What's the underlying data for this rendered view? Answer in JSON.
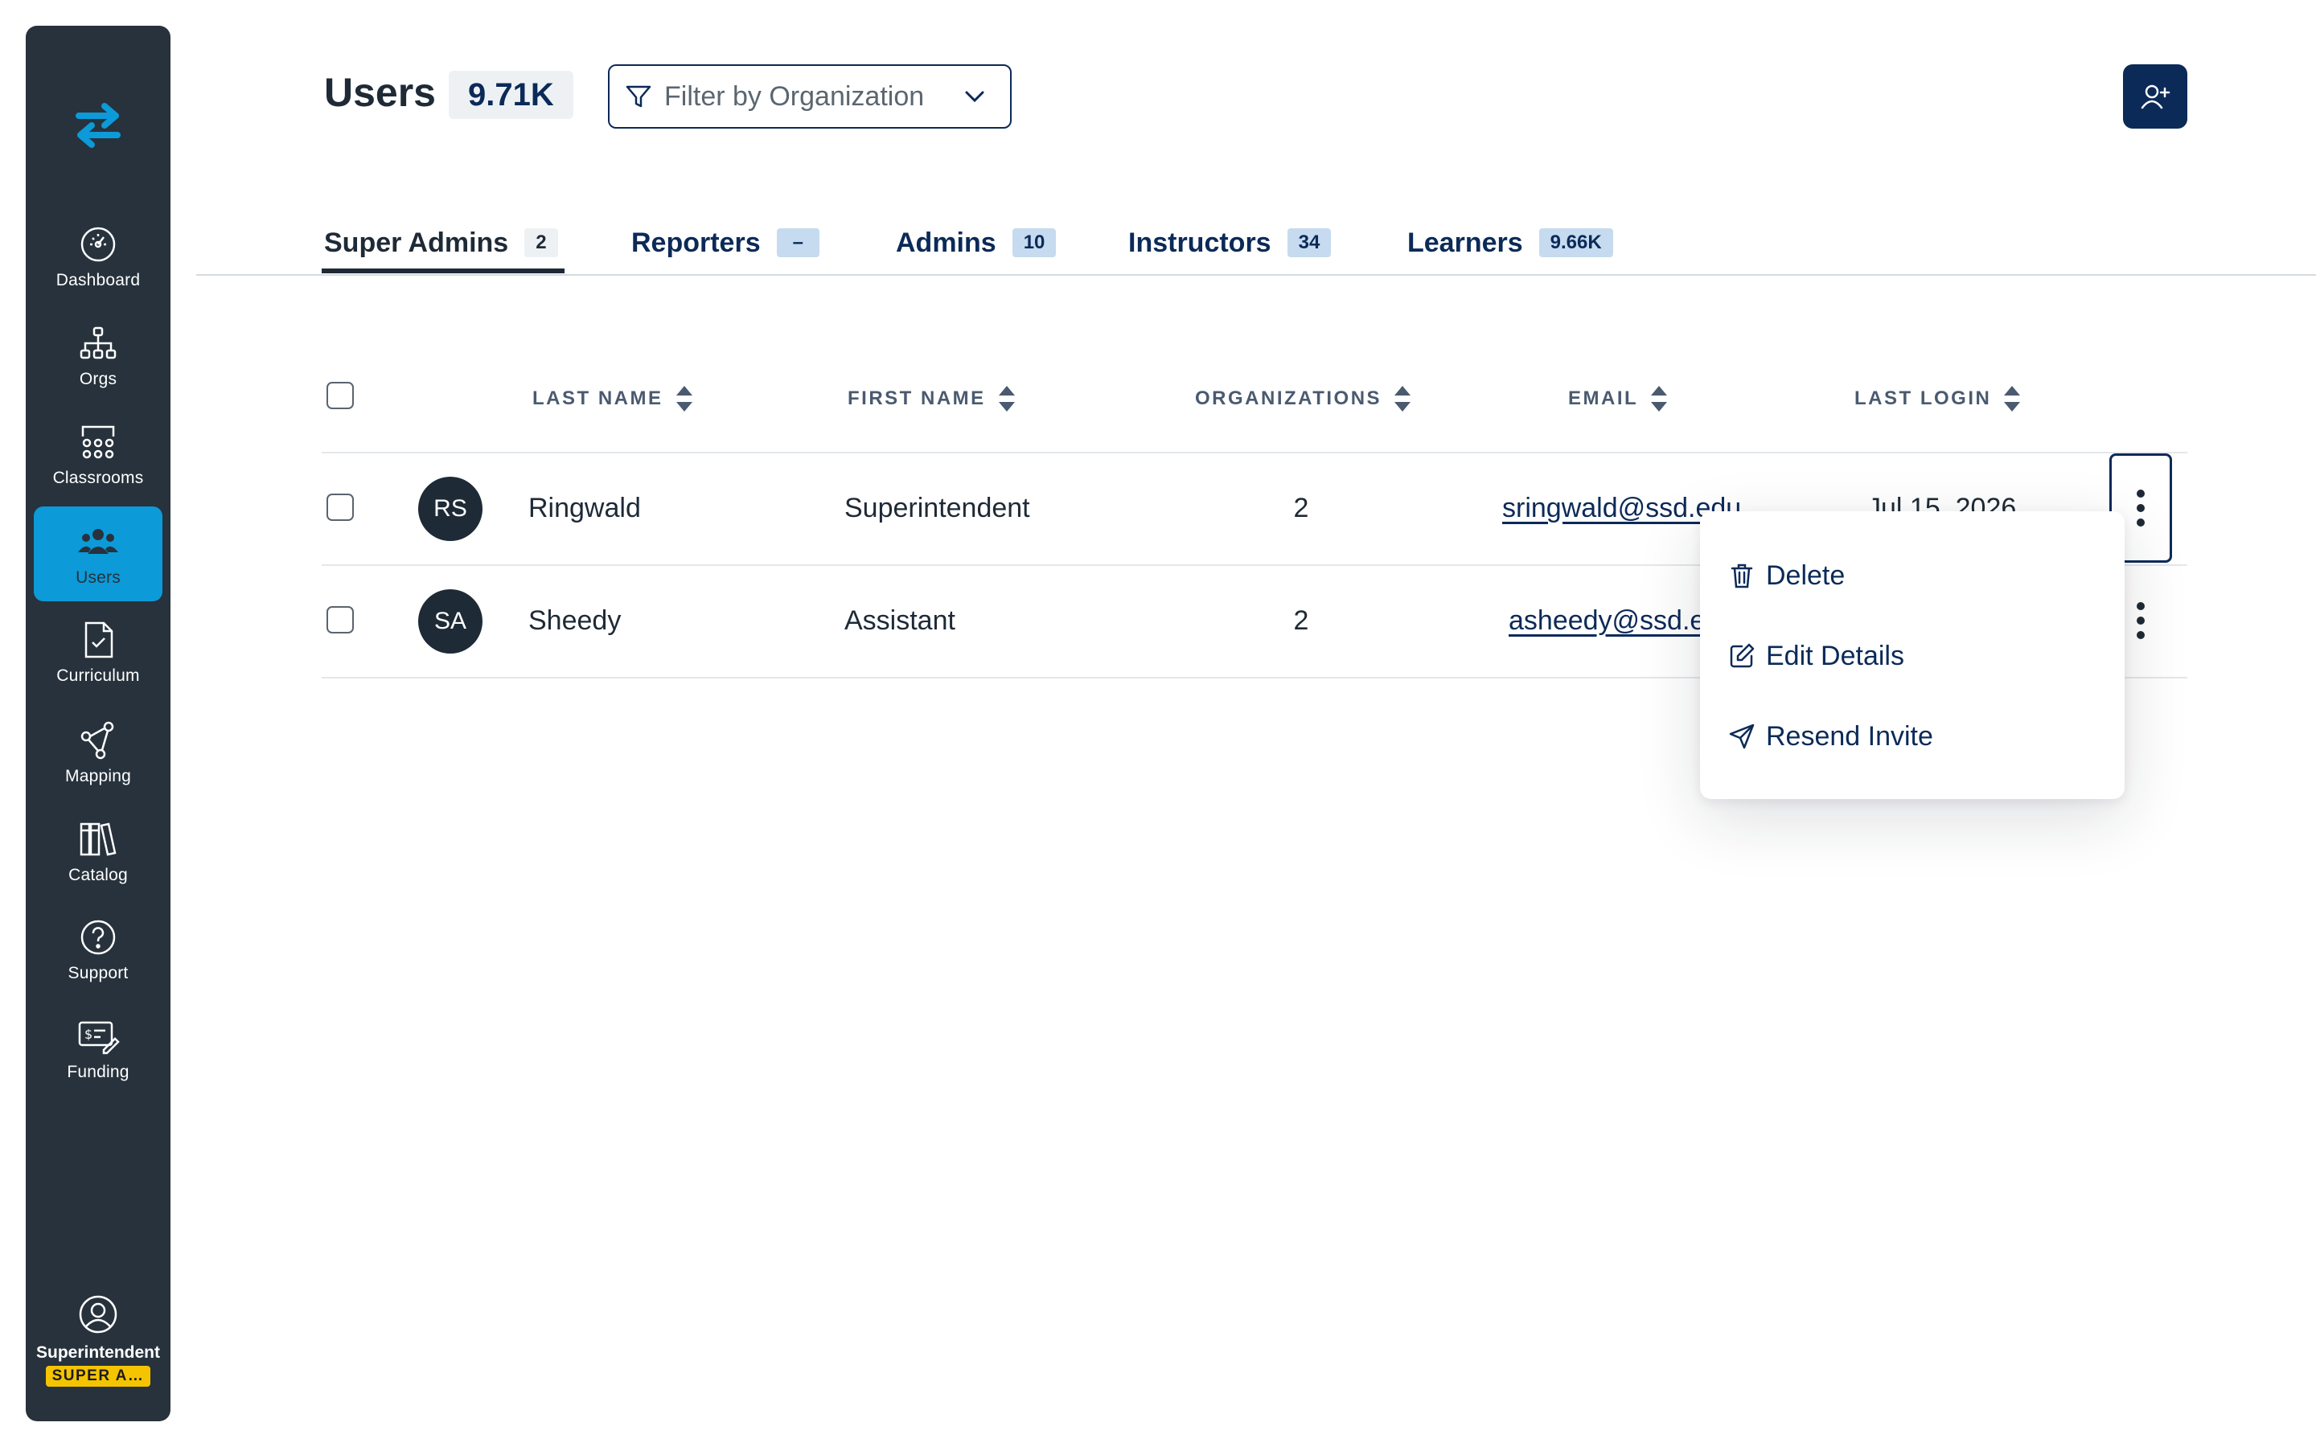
{
  "sidebar": {
    "logo_icon": "swap-arrows-icon",
    "items": [
      {
        "label": "Dashboard",
        "icon": "dashboard-icon"
      },
      {
        "label": "Orgs",
        "icon": "org-chart-icon"
      },
      {
        "label": "Classrooms",
        "icon": "classroom-icon"
      },
      {
        "label": "Users",
        "icon": "users-icon",
        "active": true
      },
      {
        "label": "Curriculum",
        "icon": "curriculum-icon"
      },
      {
        "label": "Mapping",
        "icon": "mapping-icon"
      },
      {
        "label": "Catalog",
        "icon": "catalog-icon"
      },
      {
        "label": "Support",
        "icon": "help-icon"
      },
      {
        "label": "Funding",
        "icon": "funding-icon"
      }
    ],
    "profile": {
      "name": "Superintendent",
      "role": "SUPER A…",
      "icon": "user-circle-icon"
    },
    "accent_color": "#0c9ad8",
    "background": "#27323c"
  },
  "header": {
    "title": "Users",
    "count": "9.71K",
    "filter_placeholder": "Filter by Organization",
    "add_user_icon": "add-user-icon"
  },
  "tabs": [
    {
      "label": "Super Admins",
      "count": "2",
      "active": true
    },
    {
      "label": "Reporters",
      "count": "–"
    },
    {
      "label": "Admins",
      "count": "10"
    },
    {
      "label": "Instructors",
      "count": "34"
    },
    {
      "label": "Learners",
      "count": "9.66K"
    }
  ],
  "table": {
    "columns": [
      "LAST NAME",
      "FIRST NAME",
      "ORGANIZATIONS",
      "EMAIL",
      "LAST LOGIN"
    ],
    "rows": [
      {
        "initials": "RS",
        "last_name": "Ringwald",
        "first_name": "Superintendent",
        "organizations": "2",
        "email": "sringwald@ssd.edu",
        "last_login": "Jul 15, 2026"
      },
      {
        "initials": "SA",
        "last_name": "Sheedy",
        "first_name": "Assistant",
        "organizations": "2",
        "email": "asheedy@ssd.e",
        "last_login": ""
      }
    ]
  },
  "row_menu": {
    "items": [
      {
        "label": "Delete",
        "icon": "trash-icon"
      },
      {
        "label": "Edit Details",
        "icon": "edit-icon"
      },
      {
        "label": "Resend Invite",
        "icon": "send-icon"
      }
    ]
  },
  "colors": {
    "primary": "#0b2a58",
    "text": "#1e2a36",
    "badge": "#c6dbef",
    "role_badge": "#f5c400"
  }
}
